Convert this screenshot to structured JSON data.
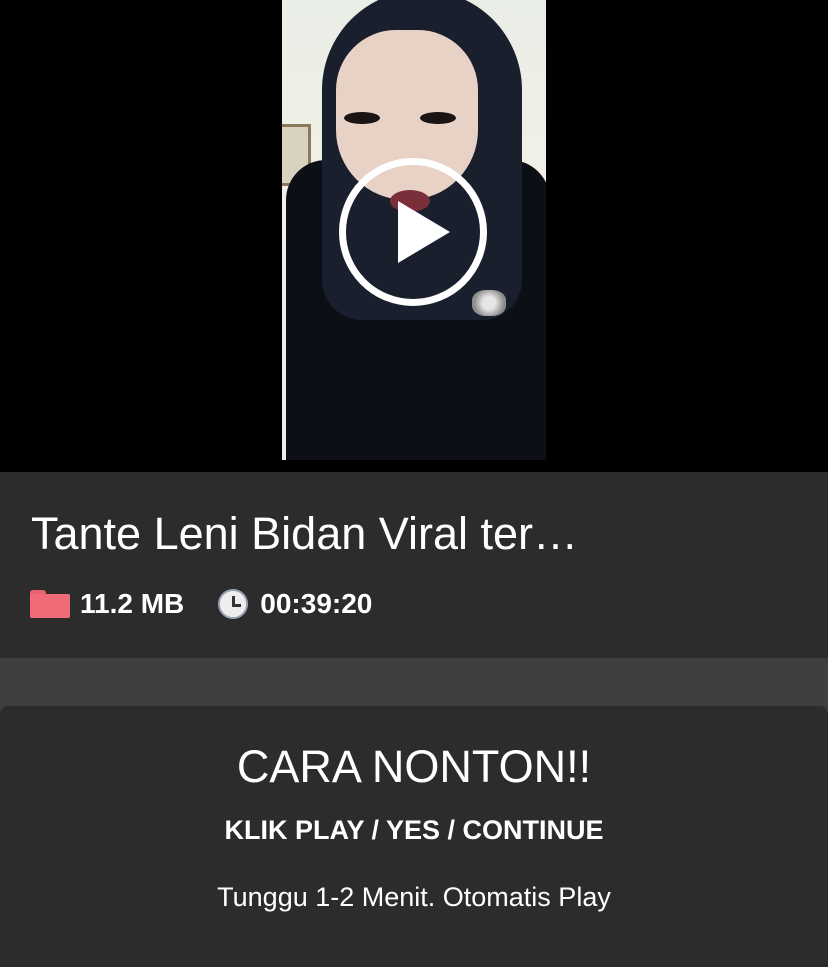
{
  "video": {
    "thumbnail_icon": "play-circle-icon"
  },
  "info": {
    "title": "Tante Leni Bidan Viral ter…",
    "size": "11.2 MB",
    "duration": "00:39:20",
    "size_icon": "folder-icon",
    "duration_icon": "clock-icon"
  },
  "howto": {
    "title": "CARA NONTON!!",
    "steps": "KLIK PLAY / YES / CONTINUE",
    "note": "Tunggu 1-2 Menit. Otomatis Play"
  },
  "colors": {
    "background": "#3f3f3f",
    "panel": "#2c2c2c",
    "folder": "#ef6b78",
    "text": "#ffffff"
  }
}
